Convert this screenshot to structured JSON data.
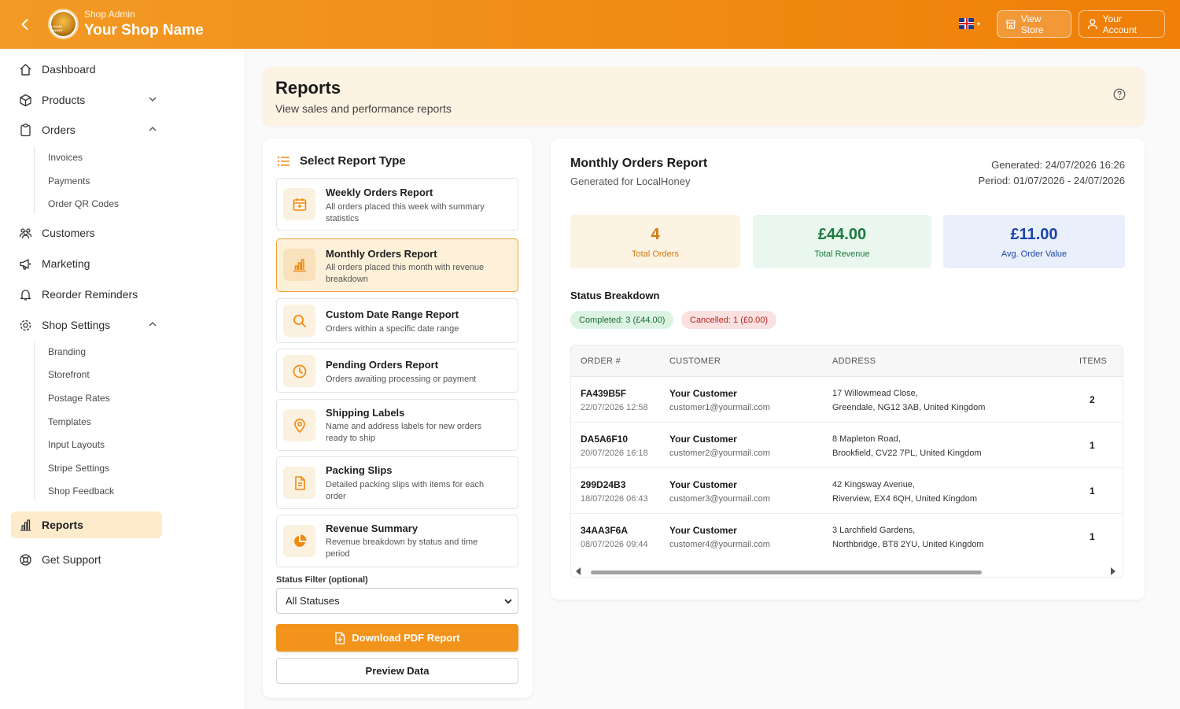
{
  "header": {
    "subtitle": "Shop Admin",
    "shop_name": "Your Shop Name",
    "view_store": "View Store",
    "your_account": "Your Account",
    "logo_text": "LOCAL HONEY",
    "accent": "#f08a12"
  },
  "sidebar": {
    "items": [
      {
        "label": "Dashboard"
      },
      {
        "label": "Products"
      },
      {
        "label": "Orders"
      },
      {
        "label": "Customers"
      },
      {
        "label": "Marketing"
      },
      {
        "label": "Reorder Reminders"
      },
      {
        "label": "Shop Settings"
      },
      {
        "label": "Reports"
      },
      {
        "label": "Get Support"
      }
    ],
    "orders_sub": [
      "Invoices",
      "Payments",
      "Order QR Codes"
    ],
    "settings_sub": [
      "Branding",
      "Storefront",
      "Postage Rates",
      "Templates",
      "Input Layouts",
      "Stripe Settings",
      "Shop Feedback"
    ]
  },
  "page": {
    "title": "Reports",
    "subtitle": "View sales and performance reports"
  },
  "report_types": {
    "heading": "Select Report Type",
    "cards": [
      {
        "title": "Weekly Orders Report",
        "desc": "All orders placed this week with summary statistics"
      },
      {
        "title": "Monthly Orders Report",
        "desc": "All orders placed this month with revenue breakdown"
      },
      {
        "title": "Custom Date Range Report",
        "desc": "Orders within a specific date range"
      },
      {
        "title": "Pending Orders Report",
        "desc": "Orders awaiting processing or payment"
      },
      {
        "title": "Shipping Labels",
        "desc": "Name and address labels for new orders ready to ship"
      },
      {
        "title": "Packing Slips",
        "desc": "Detailed packing slips with items for each order"
      },
      {
        "title": "Revenue Summary",
        "desc": "Revenue breakdown by status and time period"
      }
    ],
    "filter_label": "Status Filter (optional)",
    "filter_value": "All Statuses",
    "download_label": "Download PDF Report",
    "preview_label": "Preview Data"
  },
  "report": {
    "title": "Monthly Orders Report",
    "generated_for": "Generated for LocalHoney",
    "generated": "Generated: 24/07/2026 16:26",
    "period": "Period: 01/07/2026 - 24/07/2026",
    "stats": {
      "orders_value": "4",
      "orders_label": "Total Orders",
      "revenue_value": "£44.00",
      "revenue_label": "Total Revenue",
      "avg_value": "£11.00",
      "avg_label": "Avg. Order Value"
    },
    "status_title": "Status Breakdown",
    "completed": "Completed: 3 (£44.00)",
    "cancelled": "Cancelled: 1 (£0.00)",
    "columns": [
      "ORDER #",
      "CUSTOMER",
      "ADDRESS",
      "ITEMS"
    ],
    "rows": [
      {
        "id": "FA439B5F",
        "date": "22/07/2026 12:58",
        "name": "Your Customer",
        "email": "customer1@yourmail.com",
        "addr1": "17 Willowmead Close,",
        "addr2": "Greendale, NG12 3AB, United Kingdom",
        "items": "2"
      },
      {
        "id": "DA5A6F10",
        "date": "20/07/2026 16:18",
        "name": "Your Customer",
        "email": "customer2@yourmail.com",
        "addr1": "8 Mapleton Road,",
        "addr2": "Brookfield, CV22 7PL, United Kingdom",
        "items": "1"
      },
      {
        "id": "299D24B3",
        "date": "18/07/2026 06:43",
        "name": "Your Customer",
        "email": "customer3@yourmail.com",
        "addr1": "42 Kingsway Avenue,",
        "addr2": "Riverview, EX4 6QH, United Kingdom",
        "items": "1"
      },
      {
        "id": "34AA3F6A",
        "date": "08/07/2026 09:44",
        "name": "Your Customer",
        "email": "customer4@yourmail.com",
        "addr1": "3 Larchfield Gardens,",
        "addr2": "Northbridge, BT8 2YU, United Kingdom",
        "items": "1"
      }
    ]
  }
}
